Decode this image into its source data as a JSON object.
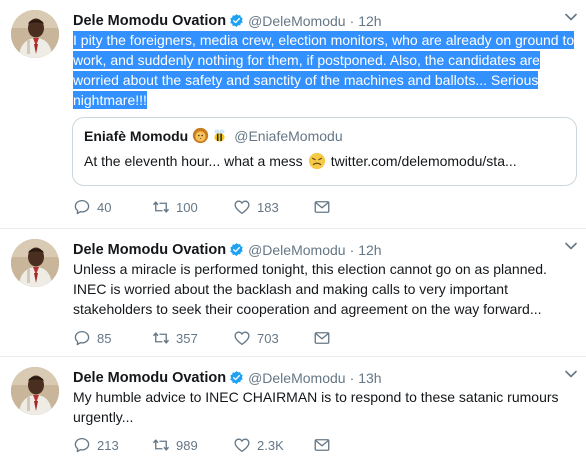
{
  "colors": {
    "selection": "#3390ff",
    "verified": "#1da1f2",
    "muted": "#657786",
    "text": "#14171a",
    "border": "#e6ecf0"
  },
  "tweets": [
    {
      "name": "Dele Momodu Ovation",
      "handle": "@DeleMomodu",
      "dot": "·",
      "time": "12h",
      "text": "I pity the foreigners, media crew, election monitors, who are already on ground to work, and suddenly nothing for them, if postponed. Also, the candidates are worried about the safety and sanctity of the machines and ballots... Serious nightmare!!!",
      "lines": [
        "I pity the foreigners, media crew, election monitors, who are already on ground to",
        "work, and suddenly nothing for them, if postponed. Also, the candidates are",
        "worried about the safety and sanctity of the machines and ballots... Serious",
        "nightmare!!!"
      ],
      "quote": {
        "name": "Eniafè Momodu",
        "emoji": [
          "lion-icon",
          "bee-icon"
        ],
        "handle": "@EniafeMomodu",
        "text_before": "At the eleventh hour... what a mess",
        "emoji_inline": "persevering-face-icon",
        "link": "twitter.com/delemomodu/sta..."
      },
      "replies": "40",
      "retweets": "100",
      "likes": "183"
    },
    {
      "name": "Dele Momodu Ovation",
      "handle": "@DeleMomodu",
      "dot": "·",
      "time": "12h",
      "lines": [
        "Unless a miracle is performed tonight, this election cannot go on as planned.",
        "INEC is worried about the backlash and making calls to very important",
        "stakeholders to seek their cooperation and agreement on the way forward..."
      ],
      "replies": "85",
      "retweets": "357",
      "likes": "703"
    },
    {
      "name": "Dele Momodu Ovation",
      "handle": "@DeleMomodu",
      "dot": "·",
      "time": "13h",
      "lines": [
        "My humble advice to INEC CHAIRMAN is to respond to these satanic rumours",
        "urgently..."
      ],
      "replies": "213",
      "retweets": "989",
      "likes": "2.3K"
    }
  ]
}
